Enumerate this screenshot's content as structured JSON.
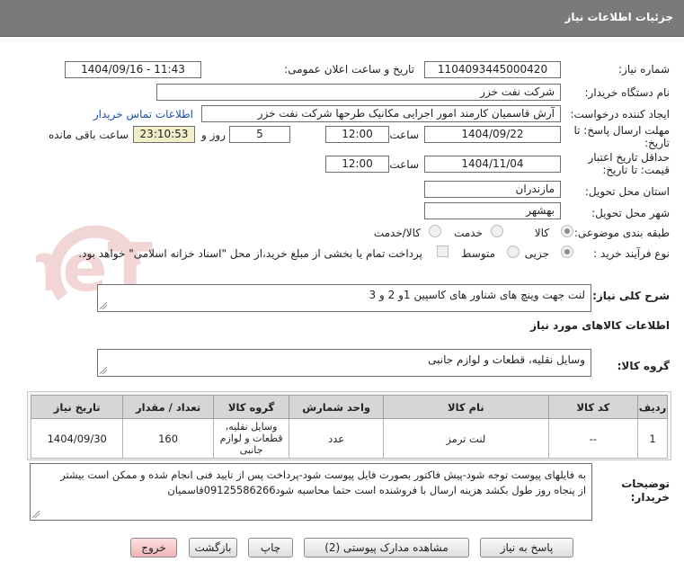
{
  "header": {
    "title": "جزئیات اطلاعات نیاز"
  },
  "form": {
    "need_number": {
      "label": "شماره نیاز:",
      "value": "1104093445000420"
    },
    "announce": {
      "label": "تاریخ و ساعت اعلان عمومی:",
      "value": "1404/09/16 - 11:43"
    },
    "buyer_org": {
      "label": "نام دستگاه خریدار:",
      "value": "شرکت نفت خزر"
    },
    "requester": {
      "label": "ایجاد کننده درخواست:",
      "value": "آرش قاسمیان کارمند امور اجرایی مکانیک طرحها شرکت نفت خزر",
      "contact_link": "اطلاعات تماس خریدار"
    },
    "deadline": {
      "label_line1": "مهلت ارسال پاسخ: تا",
      "label_line2": "تاریخ:",
      "date": "1404/09/22",
      "time_label": "ساعت",
      "time": "12:00",
      "days": "5",
      "days_label": "روز و",
      "remaining": "23:10:53",
      "remaining_label": "ساعت باقی مانده"
    },
    "validity": {
      "label_line1": "حداقل تاریخ اعتبار",
      "label_line2": "قیمت: تا تاریخ:",
      "date": "1404/11/04",
      "time_label": "ساعت",
      "time": "12:00"
    },
    "province": {
      "label": "استان محل تحویل:",
      "value": "مازندران"
    },
    "city": {
      "label": "شهر محل تحویل:",
      "value": "بهشهر"
    },
    "category": {
      "label": "طبقه بندی موضوعی:",
      "options": [
        "کالا",
        "خدمت",
        "کالا/خدمت"
      ],
      "selected": "کالا"
    },
    "process": {
      "label": "نوع فرآیند خرید :",
      "options": [
        "جزیی",
        "متوسط"
      ],
      "selected": "جزیی",
      "note": "پرداخت تمام یا بخشی از مبلغ خرید،از محل \"اسناد خزانه اسلامی\" خواهد بود."
    }
  },
  "description": {
    "label": "شرح کلی نیاز:",
    "value": "لنت جهت وینچ های شناور های کاسپین 1و 2 و 3"
  },
  "goods_section": {
    "title": "اطلاعات کالاهای مورد نیاز"
  },
  "goods_group": {
    "label": "گروه کالا:",
    "value": "وسایل نقلیه، قطعات و لوازم جانبی"
  },
  "table": {
    "headers": [
      "ردیف",
      "کد کالا",
      "نام کالا",
      "واحد شمارش",
      "گروه کالا",
      "تعداد / مقدار",
      "تاریخ نیاز"
    ],
    "rows": [
      {
        "row": "1",
        "code": "--",
        "name": "لنت ترمز",
        "unit": "عدد",
        "group": "وسایل نقلیه، قطعات و لوازم جانبی",
        "qty": "160",
        "date": "1404/09/30"
      }
    ]
  },
  "buyer_notes": {
    "label_line1": "توضیحات",
    "label_line2": "خریدار:",
    "line1": "به فایلهای پیوست توجه شود-پیش فاکتور بصورت فایل پیوست شود-پرداخت پس از تایید فنی انجام شده و ممکن است بیشتر",
    "line2": "از پنجاه روز طول بکشد هزینه ارسال با فروشنده است حتما محاسبه شود09125586266قاسمیان"
  },
  "buttons": {
    "reply": "پاسخ به نیاز",
    "docs": "مشاهده مدارک پیوستی (2)",
    "print": "چاپ",
    "back": "بازگشت",
    "exit": "خروج"
  },
  "watermark": {
    "text": "AriaTender.neT"
  },
  "colors": {
    "header_bg": "#7a7a7a",
    "link": "#1a4fb3",
    "remaining_bg": "#f2eec9",
    "exit_bg": "#f1b5b5"
  }
}
